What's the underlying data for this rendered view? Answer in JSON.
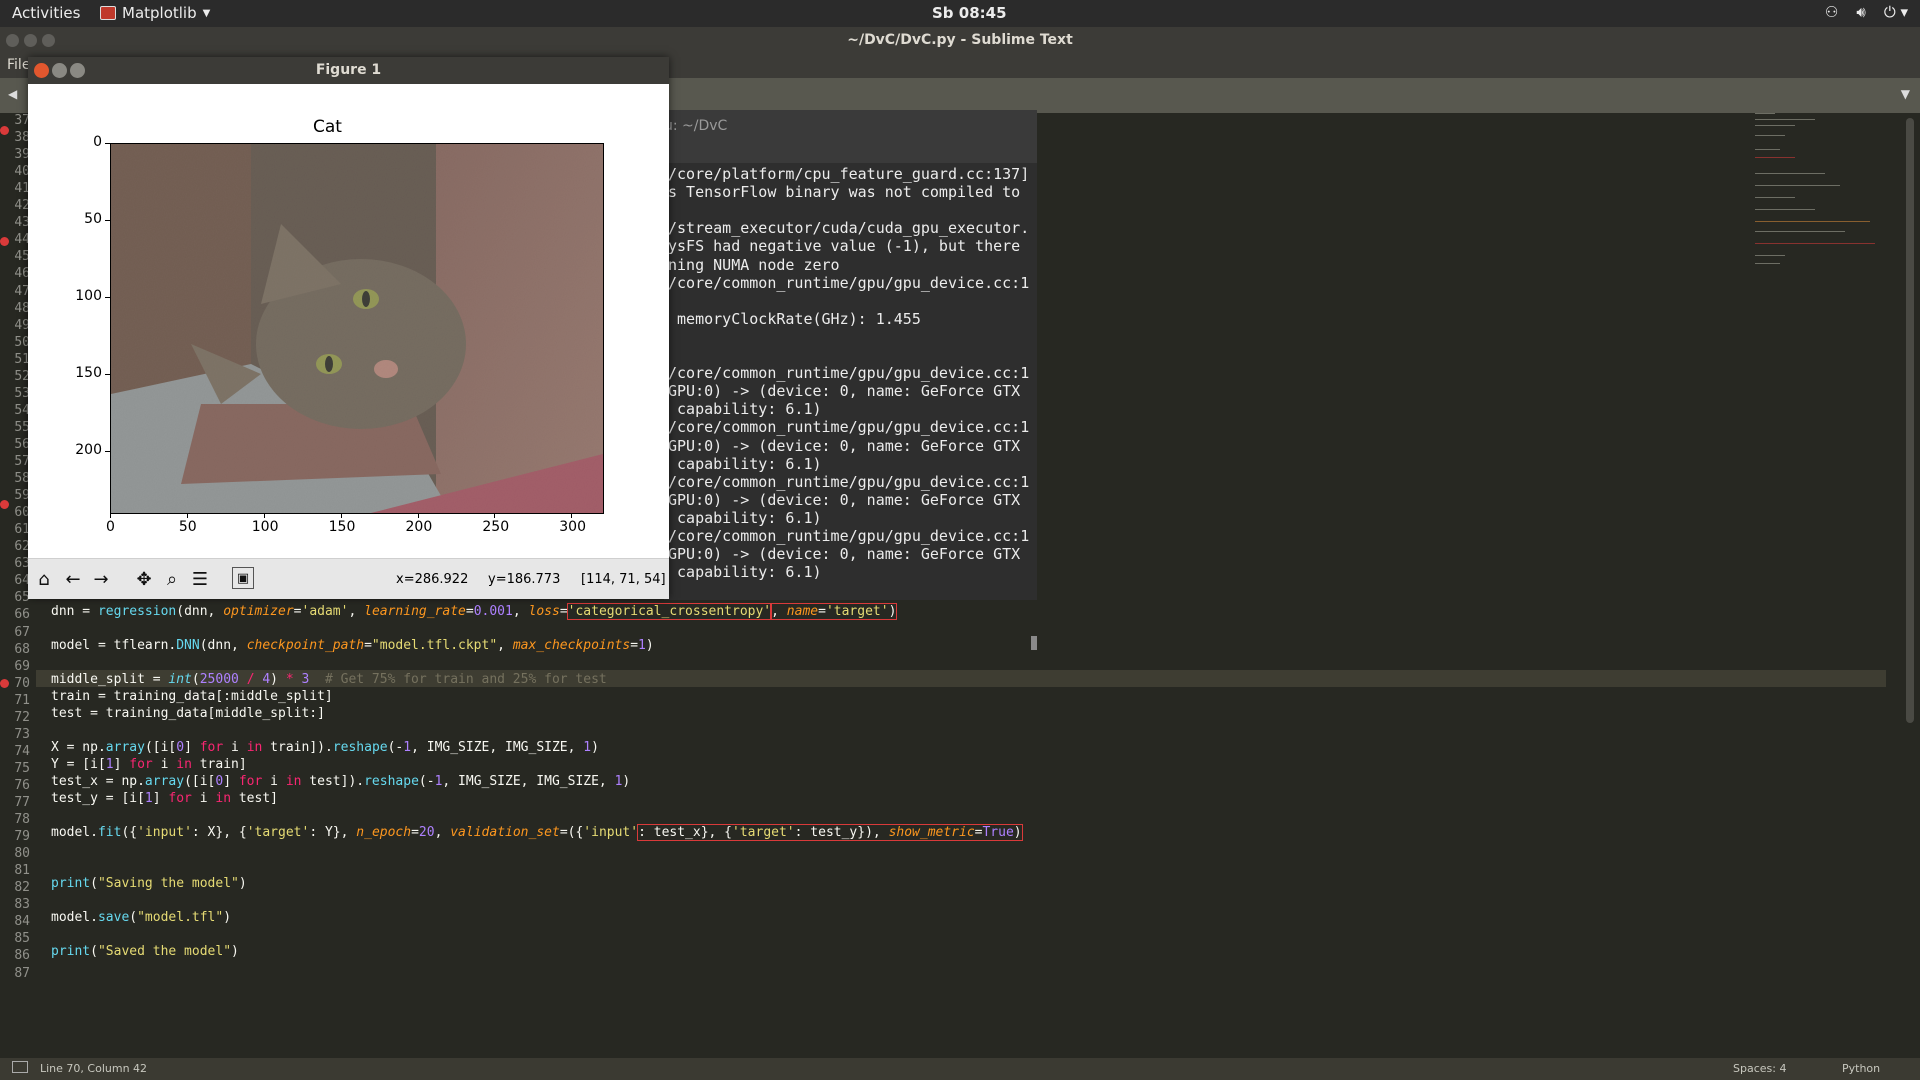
{
  "topbar": {
    "activities": "Activities",
    "app_menu": "Matplotlib",
    "clock": "Sb 08:45",
    "tray_icons": [
      "network-icon",
      "volume-icon",
      "power-icon"
    ]
  },
  "sublime": {
    "window_title": "~/DvC/DvC.py - Sublime Text",
    "menu_partial": "File",
    "status_position": "Line 70, Column 42",
    "status_spaces": "Spaces: 4",
    "status_syntax": "Python"
  },
  "gutter": [
    "37",
    "38",
    "39",
    "40",
    "41",
    "42",
    "43",
    "44",
    "45",
    "46",
    "47",
    "48",
    "49",
    "50",
    "51",
    "52",
    "53",
    "54",
    "55",
    "56",
    "57",
    "58",
    "59",
    "60",
    "61",
    "62",
    "63",
    "64",
    "65",
    "66",
    "67",
    "68",
    "69",
    "70",
    "71",
    "72",
    "73",
    "74",
    "75",
    "76",
    "77",
    "78",
    "79",
    "80",
    "81",
    "82",
    "83",
    "84",
    "85",
    "86",
    "87"
  ],
  "code": {
    "l66_a": "dnn = ",
    "l66_fn": "regression",
    "l66_b": "(dnn, ",
    "l66_p1": "optimizer",
    "l66_s1": "'adam'",
    "l66_p2": "learning_rate",
    "l66_n1": "0.001",
    "l66_p3": "loss",
    "l66_s2": "'categorical_crossentropy'",
    "l66_p4": "name",
    "l66_s3": "'target'",
    "l68_a": "model = tflearn.",
    "l68_fn": "DNN",
    "l68_b": "(dnn, ",
    "l68_p1": "checkpoint_path",
    "l68_s1": "\"model.tfl.ckpt\"",
    "l68_p2": "max_checkpoints",
    "l68_n1": "1",
    "l70_a": "middle_split = ",
    "l70_fn": "int",
    "l70_n1": "25000",
    "l70_n2": "4",
    "l70_n3": "3",
    "l70_c": "# Get 75% for train and 25% for test",
    "l71": "train = training_data[:middle_split]",
    "l72": "test = training_data[middle_split:]",
    "l74_a": "X = np.",
    "l74_fn": "array",
    "l74_b": "([i[",
    "l74_n0": "0",
    "l74_c": "] ",
    "l74_k1": "for",
    "l74_d": " i ",
    "l74_k2": "in",
    "l74_e": " train]).",
    "l74_fn2": "reshape",
    "l74_f": "(-",
    "l74_n1": "1",
    "l74_g": ", IMG_SIZE, IMG_SIZE, ",
    "l74_n2": "1",
    "l74_h": ")",
    "l75_a": "Y = [i[",
    "l75_n": "1",
    "l75_b": "] ",
    "l75_k1": "for",
    "l75_c": " i ",
    "l75_k2": "in",
    "l75_d": " train]",
    "l76_a": "test_x = np.",
    "l76_fn": "array",
    "l76_b": "([i[",
    "l76_n0": "0",
    "l76_c": "] ",
    "l76_k1": "for",
    "l76_d": " i ",
    "l76_k2": "in",
    "l76_e": " test]).",
    "l76_fn2": "reshape",
    "l76_f": "(-",
    "l76_n1": "1",
    "l76_g": ", IMG_SIZE, IMG_SIZE, ",
    "l76_n2": "1",
    "l76_h": ")",
    "l77_a": "test_y = [i[",
    "l77_n": "1",
    "l77_b": "] ",
    "l77_k1": "for",
    "l77_c": " i ",
    "l77_k2": "in",
    "l77_d": " test]",
    "l79_a": "model.",
    "l79_fn": "fit",
    "l79_b": "({",
    "l79_s1": "'input'",
    "l79_c": ": X}, {",
    "l79_s2": "'target'",
    "l79_d": ": Y}, ",
    "l79_p1": "n_epoch",
    "l79_n1": "20",
    "l79_p2": "validation_set",
    "l79_e": "({",
    "l79_s3": "'input'",
    "l79_f": ": test_x}, {",
    "l79_s4": "'target'",
    "l79_g": ": test_y}), ",
    "l79_p3": "show_metric",
    "l79_n2": "True",
    "l82_fn": "print",
    "l82_s": "\"Saving the model\"",
    "l84_a": "model.",
    "l84_fn": "save",
    "l84_s": "\"model.tfl\"",
    "l86_fn": "print",
    "l86_s": "\"Saved the model\""
  },
  "terminal": {
    "title_partial": "u: ~/DvC",
    "lines": [
      "/core/platform/cpu_feature_guard.cc:137]",
      "s TensorFlow binary was not compiled to",
      "",
      "/stream_executor/cuda/cuda_gpu_executor.",
      "ysFS had negative value (-1), but there",
      "ning NUMA node zero",
      "/core/common_runtime/gpu/gpu_device.cc:1",
      "",
      " memoryClockRate(GHz): 1.455",
      "",
      "",
      "/core/common_runtime/gpu/gpu_device.cc:1",
      "GPU:0) -> (device: 0, name: GeForce GTX",
      " capability: 6.1)",
      "/core/common_runtime/gpu/gpu_device.cc:1",
      "GPU:0) -> (device: 0, name: GeForce GTX",
      " capability: 6.1)",
      "/core/common_runtime/gpu/gpu_device.cc:1",
      "GPU:0) -> (device: 0, name: GeForce GTX",
      " capability: 6.1)",
      "/core/common_runtime/gpu/gpu_device.cc:1",
      "GPU:0) -> (device: 0, name: GeForce GTX",
      " capability: 6.1)"
    ]
  },
  "figure": {
    "window_title": "Figure 1",
    "plot_title": "Cat",
    "y_ticks": [
      "0",
      "50",
      "100",
      "150",
      "200"
    ],
    "x_ticks": [
      "0",
      "50",
      "100",
      "150",
      "200",
      "250",
      "300"
    ],
    "coord_x": "x=286.922",
    "coord_y": "y=186.773",
    "pixel_value": "[114, 71, 54]",
    "toolbar_icons": [
      "home-icon",
      "back-arrow-icon",
      "forward-arrow-icon",
      "pan-icon",
      "zoom-icon",
      "configure-subplots-icon",
      "save-icon"
    ]
  }
}
